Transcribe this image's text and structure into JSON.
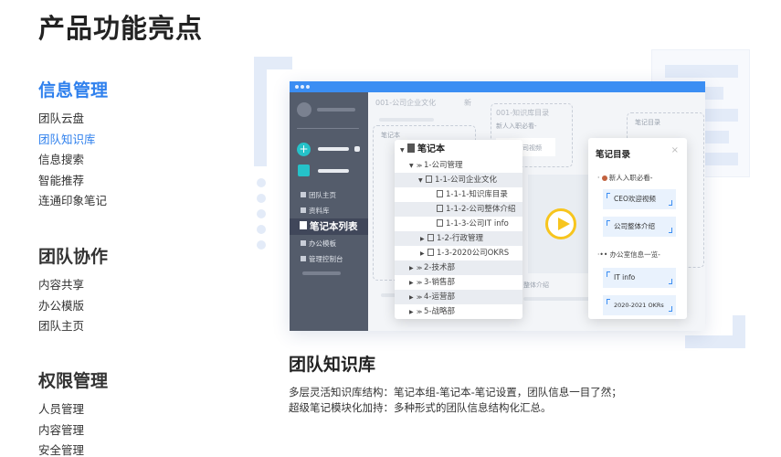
{
  "page_title": "产品功能亮点",
  "categories": [
    {
      "title": "信息管理",
      "items": [
        "团队云盘",
        "团队知识库",
        "信息搜索",
        "智能推荐",
        "连通印象笔记"
      ]
    },
    {
      "title": "团队协作",
      "items": [
        "内容共享",
        "办公模版",
        "团队主页"
      ]
    },
    {
      "title": "权限管理",
      "items": [
        "人员管理",
        "内容管理",
        "安全管理"
      ]
    }
  ],
  "active_category": "信息管理",
  "active_item": "团队知识库",
  "preview": {
    "sidebar": {
      "items": [
        "团队主页",
        "资料库"
      ],
      "selected": "笔记本列表",
      "items_after": [
        "办公模板",
        "管理控制台"
      ]
    },
    "ghost": {
      "tab1": "001-公司企业文化",
      "tab1_suffix": "新",
      "tab2": "001-知识库目录",
      "tab2_sub": "新人入职必看-",
      "tab2_card": "公司视频",
      "ghost_card3": "笔记目录",
      "ghost_tree_label1": "笔记本",
      "ghost_bottom": "整体介绍"
    },
    "tree": {
      "root": "笔记本",
      "rows": [
        "1-公司管理",
        "1-1-公司企业文化",
        "1-1-1-知识库目录",
        "1-1-2-公司整体介绍",
        "1-1-3-公司IT info",
        "1-2-行政管理",
        "1-3-2020公司OKRS",
        "2-技术部",
        "3-销售部",
        "4-运营部",
        "5-战略部"
      ]
    },
    "catalog": {
      "title": "笔记目录",
      "close": "×",
      "section1": "新人入职必看-",
      "cards1": [
        "CEO欢迎视频",
        "公司整体介绍"
      ],
      "section2": "办公室信息一览-",
      "cards2": [
        "IT info",
        "2020-2021 OKRs"
      ]
    }
  },
  "feature": {
    "title": "团队知识库",
    "desc_line1": "多层灵活知识库结构：笔记本组-笔记本-笔记设置，团队信息一目了然；",
    "desc_line2": "超级笔记模块化加持：多种形式的团队信息结构化汇总。"
  },
  "colors": {
    "accent": "#2f80ed",
    "teal": "#25c2c9",
    "sidebar": "#545c6b",
    "play": "#f7c51e"
  }
}
